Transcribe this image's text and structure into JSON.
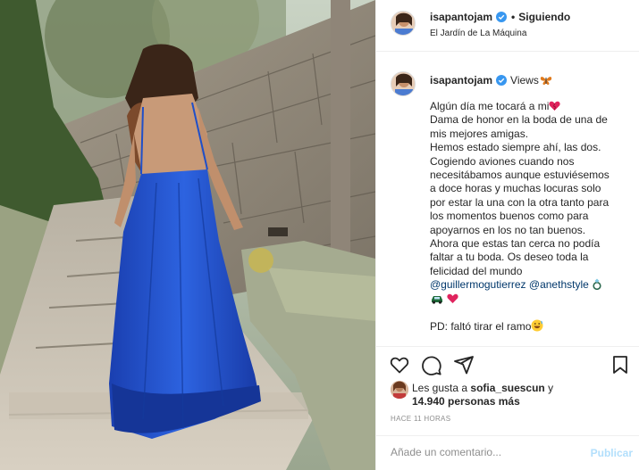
{
  "post": {
    "username": "isapantojam",
    "dot": "•",
    "follow_label": "Siguiendo",
    "location": "El Jardín de La Máquina"
  },
  "caption": {
    "username": "isapantojam",
    "title_suffix": "Views",
    "lines": [
      "Algún día me tocará a mi",
      "Dama de honor en la boda de una de",
      "mis mejores amigas.",
      "Hemos estado siempre ahí, las dos.",
      "Cogiendo aviones cuando nos",
      "necesitábamos aunque estuviésemos",
      "a doce horas y muchas locuras solo",
      "por estar la una con la otra tanto para",
      "los momentos buenos como para",
      "apoyarnos en los no tan buenos.",
      "Ahora que estas tan cerca no podía",
      "faltar a tu boda. Os deseo toda la",
      "felicidad del mundo"
    ],
    "mention_1": "@guillermogutierrez",
    "mention_2": "@anethstyle",
    "ps": "PD: faltó tirar el ramo"
  },
  "icons": {
    "verified": "verified-badge-icon",
    "butterfly": "butterfly-emoji-icon",
    "heart_emoji": "red-heart-emoji-icon",
    "ring": "ring-emoji-icon",
    "car": "car-emoji-icon",
    "laugh": "grinning-sweat-emoji-icon",
    "like": "heart-outline-icon",
    "comment": "comment-bubble-icon",
    "share": "paper-plane-icon",
    "save": "bookmark-icon"
  },
  "likes": {
    "prefix": "Les gusta a",
    "user": "sofia_suescun",
    "conj": "y",
    "count": "14.940 personas más"
  },
  "timestamp": "Hace 11 horas",
  "comment": {
    "placeholder": "Añade un comentario...",
    "publish_label": "Publicar"
  },
  "colors": {
    "verified_blue": "#3897f0",
    "dress_blue": "#1f4fc9",
    "link": "#00376b",
    "publish_disabled": "#b2dffc",
    "muted": "#8e8e8e"
  }
}
